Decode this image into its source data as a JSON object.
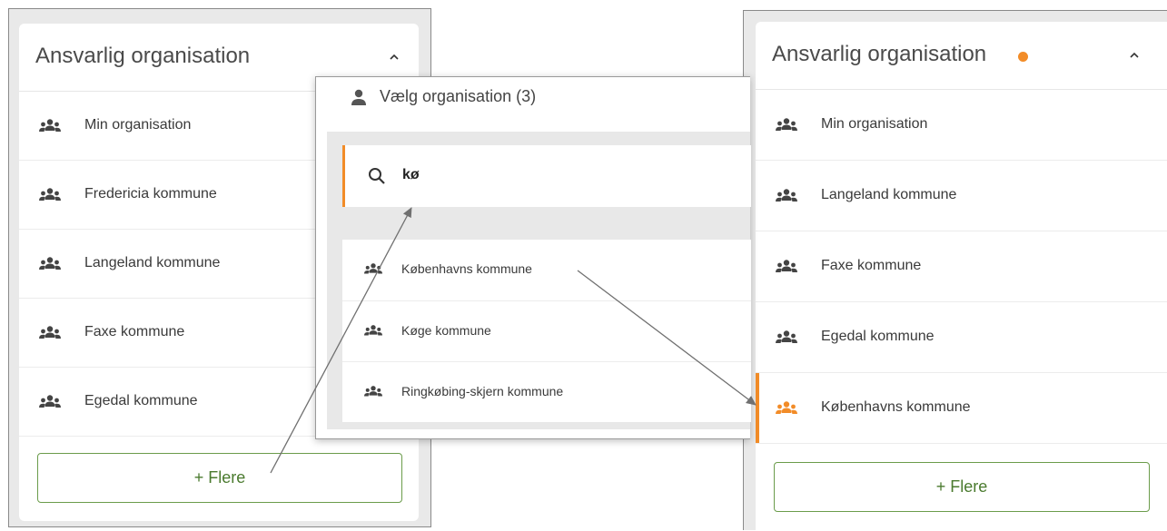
{
  "colors": {
    "accent": "#f28c28",
    "green": "#4a7a2e",
    "text": "#3a3a3a"
  },
  "left_panel": {
    "title": "Ansvarlig organisation",
    "items": [
      {
        "label": "Min organisation",
        "icon": "group-icon"
      },
      {
        "label": "Fredericia kommune",
        "icon": "group-icon"
      },
      {
        "label": "Langeland kommune",
        "icon": "group-icon"
      },
      {
        "label": "Faxe kommune",
        "icon": "group-icon"
      },
      {
        "label": "Egedal kommune",
        "icon": "group-icon"
      }
    ],
    "more_button": "+ Flere"
  },
  "dialog": {
    "title": "Vælg organisation (3)",
    "search_value": "kø",
    "results": [
      {
        "label": "Københavns kommune",
        "icon": "group-icon"
      },
      {
        "label": "Køge kommune",
        "icon": "group-icon"
      },
      {
        "label": "Ringkøbing-skjern kommune",
        "icon": "group-icon"
      }
    ]
  },
  "right_panel": {
    "title": "Ansvarlig organisation",
    "items": [
      {
        "label": "Min organisation",
        "icon": "group-icon"
      },
      {
        "label": "Langeland kommune",
        "icon": "group-icon"
      },
      {
        "label": "Faxe kommune",
        "icon": "group-icon"
      },
      {
        "label": "Egedal kommune",
        "icon": "group-icon"
      },
      {
        "label": "Københavns kommune",
        "icon": "group-icon",
        "selected": true
      }
    ],
    "more_button": "+ Flere"
  }
}
